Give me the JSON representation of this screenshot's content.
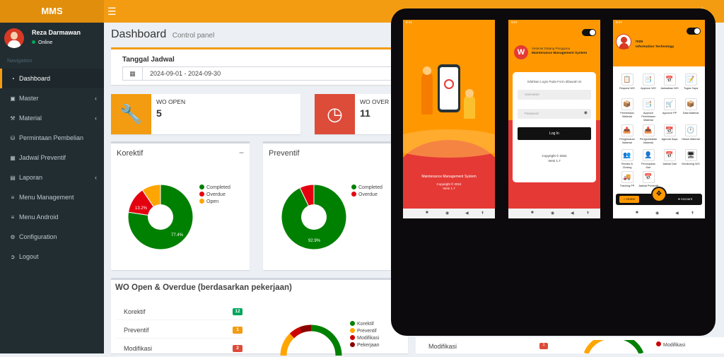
{
  "app": {
    "logo": "MMS"
  },
  "user": {
    "name": "Reza Darmawan",
    "status": "Online"
  },
  "nav": {
    "header": "Navigation",
    "items": [
      {
        "label": "Dashboard",
        "icon": "dashboard-icon"
      },
      {
        "label": "Master",
        "icon": "bank-icon"
      },
      {
        "label": "Material",
        "icon": "wrench-icon"
      },
      {
        "label": "Permintaan Pembelian",
        "icon": "cart-icon"
      },
      {
        "label": "Jadwal Preventif",
        "icon": "calendar-icon"
      },
      {
        "label": "Laporan",
        "icon": "book-icon"
      },
      {
        "label": "Menu Management",
        "icon": "list-icon"
      },
      {
        "label": "Menu Android",
        "icon": "list-icon"
      },
      {
        "label": "Configuration",
        "icon": "gears-icon"
      },
      {
        "label": "Logout",
        "icon": "logout-icon"
      }
    ]
  },
  "page": {
    "title": "Dashboard",
    "subtitle": "Control panel"
  },
  "schedule": {
    "label": "Tanggal Jadwal",
    "value": "2024-09-01 - 2024-09-30"
  },
  "info_boxes": [
    {
      "label": "WO OPEN",
      "value": "5",
      "color": "#f39c12",
      "icon": "wrench-icon"
    },
    {
      "label": "WO OVER",
      "value": "11",
      "color": "#dd4b39",
      "icon": "clock-icon"
    }
  ],
  "colors": {
    "completed": "#008000",
    "overdue": "#e4000f",
    "open": "#ffa500",
    "modifikasi": "#cc0000",
    "pekerjaan": "#8b0000",
    "accent": "#f39c12"
  },
  "korektif": {
    "title": "Korektif",
    "legend": [
      "Completed",
      "Overdue",
      "Open"
    ],
    "slices": [
      77.4,
      13.2,
      9.4
    ],
    "labels": [
      "77.4%",
      "13.2%"
    ]
  },
  "preventif": {
    "title": "Preventif",
    "legend": [
      "Completed",
      "Overdue"
    ],
    "slices": [
      92.9,
      7.1
    ],
    "labels": [
      "92.9%"
    ]
  },
  "wo_section": {
    "title": "WO Open & Overdue (berdasarkan pekerjaan)",
    "rows": [
      {
        "label": "Korektif",
        "badge": "12",
        "color": "#00a65a"
      },
      {
        "label": "Preventif",
        "badge": "1",
        "color": "#f39c12"
      },
      {
        "label": "Modifikasi",
        "badge": "2",
        "color": "#dd4b39"
      }
    ],
    "legend": [
      "Korektif",
      "Preventif",
      "Modifikasi",
      "Pekerjaan"
    ],
    "behind_label": "Modifikasi",
    "behind_badge": "1",
    "behind_legend": "Modifikasi"
  },
  "phones": {
    "splash": {
      "time": "9:44",
      "app_name": "Maintenance Management System",
      "copyright": "Copyright © 2024",
      "version": "Versi 1.7"
    },
    "login": {
      "time": "9:47",
      "welcome": "Selamat Datang Pengguna",
      "app_name": "Maintenance Management System",
      "instruction": "Silahkan Login Pada Form dibawah ini",
      "username_placeholder": "Username",
      "password_placeholder": "Password",
      "login_button": "Log In",
      "copyright": "Copyright © 2024",
      "version": "Versi 1.7"
    },
    "home": {
      "time": "9:47",
      "user_name": "reza",
      "department": "Information Technology",
      "menu": [
        "Request WO",
        "Approve WO",
        "Jadwalkan WO",
        "Tugas Saya",
        "Permintaan Material",
        "Approve Permintaan Material",
        "Approve PP",
        "Data Material",
        "Pengeluaran Material",
        "Pengembalian Material",
        "Agenda Saya",
        "Histori Material",
        "Review & Closing",
        "Penunjukan Dari",
        "Jadwal Dari",
        "Monitoring WO",
        "Tracking PP",
        "Jadwal Preventif"
      ],
      "tab_home": "Home",
      "tab_account": "Account"
    }
  }
}
